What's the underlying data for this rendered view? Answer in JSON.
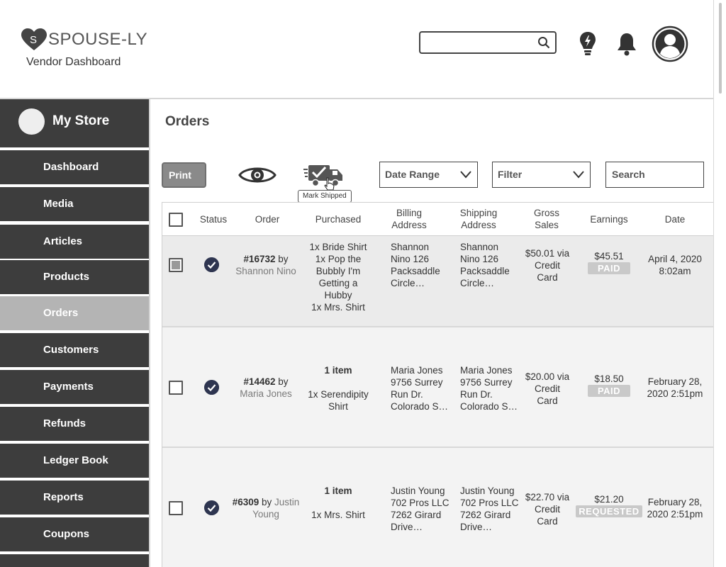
{
  "brand": {
    "name": "SPOUSE-LY",
    "subtitle": "Vendor Dashboard"
  },
  "header": {
    "search_placeholder": "",
    "icons": [
      "lightbulb-icon",
      "bell-icon",
      "user-avatar-icon"
    ]
  },
  "sidebar": {
    "store_name": "My Store",
    "items": [
      {
        "label": "Dashboard"
      },
      {
        "label": "Media"
      },
      {
        "label": "Articles"
      },
      {
        "label": "Products"
      },
      {
        "label": "Orders"
      },
      {
        "label": "Customers"
      },
      {
        "label": "Payments"
      },
      {
        "label": "Refunds"
      },
      {
        "label": "Ledger Book"
      },
      {
        "label": "Reports"
      },
      {
        "label": "Coupons"
      }
    ],
    "active": "Orders"
  },
  "main": {
    "title": "Orders",
    "toolbar": {
      "print_label": "Print",
      "mark_shipped_tooltip": "Mark Shipped",
      "date_range_label": "Date Range",
      "filter_label": "Filter",
      "search_placeholder": "Search"
    },
    "table": {
      "headers": {
        "status": "Status",
        "order": "Order",
        "purchased": "Purchased",
        "billing_1": "Billing",
        "billing_2": "Address",
        "shipping_1": "Shipping",
        "shipping_2": "Address",
        "gross_1": "Gross",
        "gross_2": "Sales",
        "earnings": "Earnings",
        "date": "Date"
      },
      "rows": [
        {
          "selected": true,
          "order_num": "#16732",
          "by": "by",
          "customer_1": "Shannon Nino",
          "customer_2": "",
          "purchased": [
            "1x Bride Shirt",
            "1x Pop the",
            "Bubbly I'm",
            "Getting a",
            "Hubby",
            "1x Mrs. Shirt"
          ],
          "billing": [
            "Shannon",
            "Nino 126",
            "Packsaddle",
            "Circle…"
          ],
          "shipping": [
            "Shannon",
            "Nino 126",
            "Packsaddle",
            "Circle…"
          ],
          "gross": [
            "$50.01 via",
            "Credit",
            "Card"
          ],
          "earnings": "$45.51",
          "earnings_status": "PAID",
          "date": [
            "April 4,  2020",
            "8:02am"
          ]
        },
        {
          "selected": false,
          "order_num": "#14462",
          "by": "by",
          "customer_1": "Maria Jones",
          "customer_2": "",
          "purchased_count": "1 item",
          "purchased": [
            "1x Serendipity",
            "Shirt"
          ],
          "billing": [
            "Maria Jones",
            "9756 Surrey",
            "Run Dr.",
            "Colorado S…"
          ],
          "shipping": [
            "Maria Jones",
            "9756 Surrey",
            "Run Dr.",
            "Colorado S…"
          ],
          "gross": [
            "$20.00 via",
            "Credit",
            "Card"
          ],
          "earnings": "$18.50",
          "earnings_status": "PAID",
          "date": [
            "February 28,",
            "2020 2:51pm"
          ]
        },
        {
          "selected": false,
          "order_num": "#6309",
          "by": "by",
          "customer_1": "Justin",
          "customer_2": "Young",
          "purchased_count": "1 item",
          "purchased": [
            "1x Mrs. Shirt"
          ],
          "billing": [
            "Justin Young",
            "702 Pros LLC",
            "7262 Girard",
            "Drive…"
          ],
          "shipping": [
            "Justin Young",
            "702 Pros LLC",
            "7262 Girard",
            "Drive…"
          ],
          "gross": [
            "$22.70 via",
            "Credit",
            "Card"
          ],
          "earnings": "$21.20",
          "earnings_status": "REQUESTED",
          "date": [
            "February 28,",
            "2020 2:51pm"
          ]
        }
      ]
    }
  },
  "colors": {
    "sidebar_bg": "#3d3d3d",
    "sidebar_active": "#b4b4b4",
    "status_check": "#2e3550",
    "badge": "#c9c9c9"
  }
}
